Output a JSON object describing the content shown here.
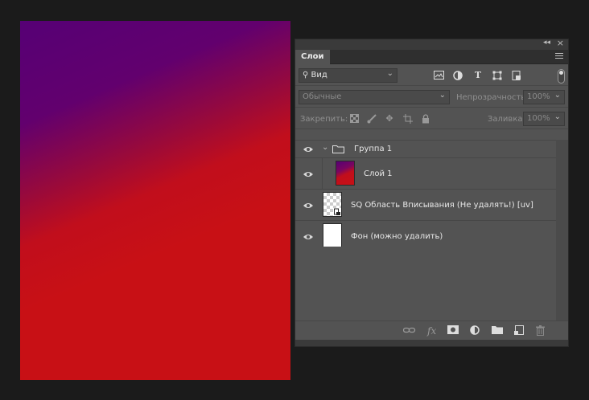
{
  "panel": {
    "tab_label": "Слои",
    "filter": {
      "value": "Вид"
    },
    "blend_mode": {
      "value": "Обычные"
    },
    "opacity": {
      "label": "Непрозрачность:",
      "value": "100%"
    },
    "lock": {
      "label": "Закрепить:"
    },
    "fill": {
      "label": "Заливка:",
      "value": "100%"
    },
    "layers": [
      {
        "name": "Группа 1",
        "type": "group"
      },
      {
        "name": "Слой 1",
        "type": "layer"
      },
      {
        "name": "SQ Область Вписывания (Не удалять!) [uv]",
        "type": "smart-object"
      },
      {
        "name": "Фон (можно удалить)",
        "type": "background"
      }
    ]
  },
  "icons": {
    "collapse": "double-chevron-icon",
    "close": "close-icon",
    "menu": "panel-menu-icon",
    "filter_kinds": [
      "image-filter-icon",
      "adjustment-filter-icon",
      "type-filter-icon",
      "shape-filter-icon",
      "smartobject-filter-icon"
    ],
    "footer": [
      "link-icon",
      "fx-icon",
      "mask-icon",
      "adjustment-icon",
      "folder-icon",
      "new-layer-icon",
      "trash-icon"
    ]
  },
  "colors": {
    "canvas_gradient_start": "#560075",
    "canvas_gradient_end": "#c81015",
    "panel_bg": "#535353",
    "app_bg": "#1b1b1b"
  }
}
